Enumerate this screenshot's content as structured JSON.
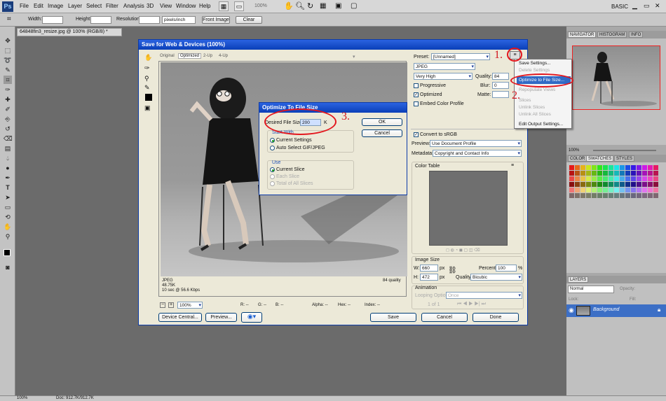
{
  "menubar": {
    "logo": "Ps",
    "items": [
      "File",
      "Edit",
      "Image",
      "Layer",
      "Select",
      "Filter",
      "Analysis",
      "3D",
      "View",
      "Window",
      "Help"
    ],
    "zoom": "100%",
    "workspace": "BASIC"
  },
  "options_bar": {
    "width_label": "Width:",
    "height_label": "Height:",
    "resolution_label": "Resolution:",
    "unit": "pixels/inch",
    "front_image": "Front Image",
    "clear": "Clear"
  },
  "document": {
    "tab": "64848fin3_resize.jpg @ 100% (RGB/8) *",
    "status_zoom": "100%",
    "doc_size": "Doc: 912.7K/912.7K"
  },
  "right_panels": {
    "navigator_tabs": [
      "NAVIGATOR",
      "HISTOGRAM",
      "INFO"
    ],
    "nav_zoom": "100%",
    "color_tabs": [
      "COLOR",
      "SWATCHES",
      "STYLES"
    ],
    "layers_tab": "LAYERS",
    "blend_mode": "Normal",
    "opacity_label": "Opacity:",
    "lock_label": "Lock:",
    "fill_label": "Fill:",
    "layer_name": "Background"
  },
  "dialog": {
    "title": "Save for Web & Devices (100%)",
    "view_tabs": [
      "Original",
      "Optimized",
      "2-Up",
      "4-Up"
    ],
    "image_info": [
      "JPEG",
      "48.75K",
      "10 sec @ 56.6 Kbps"
    ],
    "quality_info": "84 quality",
    "zoom_value": "100%",
    "readouts": [
      "R: --",
      "G: --",
      "B: --",
      "Alpha: --",
      "Hex: --",
      "Index: --"
    ],
    "device_central": "Device Central...",
    "preview": "Preview...",
    "save": "Save",
    "cancel": "Cancel",
    "done": "Done"
  },
  "settings": {
    "preset_label": "Preset:",
    "preset_value": "[Unnamed]",
    "format": "JPEG",
    "quality_level": "Very High",
    "quality_label": "Quality:",
    "quality_value": "84",
    "progressive": "Progressive",
    "blur_label": "Blur:",
    "blur_value": "0",
    "optimized": "Optimized",
    "matte_label": "Matte:",
    "embed_profile": "Embed Color Profile",
    "convert_srgb": "Convert to sRGB",
    "preview_label": "Preview:",
    "preview_value": "Use Document Profile",
    "metadata_label": "Metadata:",
    "metadata_value": "Copyright and Contact Info",
    "color_table": "Color Table",
    "image_size": "Image Size",
    "w_label": "W:",
    "w_value": "660",
    "h_label": "H:",
    "h_value": "472",
    "px": "px",
    "percent_label": "Percent:",
    "percent_value": "100",
    "percent_unit": "%",
    "resample_label": "Quality:",
    "resample_value": "Bicubic",
    "animation": "Animation",
    "looping_label": "Looping Options:",
    "looping_value": "Once",
    "frame_counter": "1 of 1"
  },
  "flyout_menu": {
    "items": [
      {
        "label": "Save Settings...",
        "disabled": false
      },
      {
        "label": "Delete Settings",
        "disabled": true
      },
      {
        "label": "Optimize to File Size...",
        "disabled": false
      },
      {
        "label": "Repopulate Views",
        "disabled": true
      },
      {
        "label": "Slices",
        "disabled": true
      },
      {
        "label": "Unlink Slices",
        "disabled": true
      },
      {
        "label": "Unlink All Slices",
        "disabled": true
      },
      {
        "label": "Edit Output Settings...",
        "disabled": false
      }
    ]
  },
  "optimize_dialog": {
    "title": "Optimize To File Size",
    "desired_label": "Desired File Size:",
    "desired_value": "200",
    "unit": "K",
    "ok": "OK",
    "cancel": "Cancel",
    "start_with": "Start With",
    "current_settings": "Current Settings",
    "auto_select": "Auto Select GIF/JPEG",
    "use": "Use",
    "current_slice": "Current Slice",
    "each_slice": "Each Slice",
    "total_slices": "Total of All Slices"
  },
  "annotations": [
    "1.",
    "2.",
    "3."
  ]
}
